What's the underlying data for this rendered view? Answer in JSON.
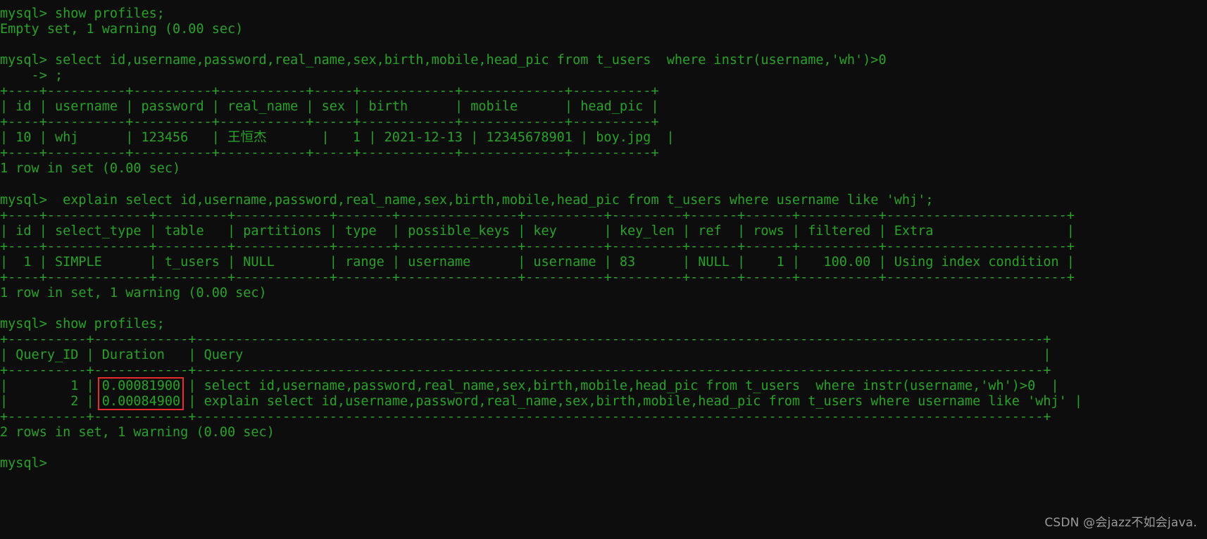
{
  "terminal": {
    "title": "mysql-client-terminal",
    "prompt": "mysql>",
    "colors": {
      "background": "#0d0d0d",
      "text": "#27a327",
      "highlight_border": "#e82c2c",
      "watermark": "#9a9a9a"
    },
    "lines": [
      "mysql> show profiles;",
      "Empty set, 1 warning (0.00 sec)",
      "",
      "mysql> select id,username,password,real_name,sex,birth,mobile,head_pic from t_users  where instr(username,'wh')>0",
      "    -> ;",
      "+----+----------+----------+-----------+-----+------------+-------------+----------+",
      "| id | username | password | real_name | sex | birth      | mobile      | head_pic |",
      "+----+----------+----------+-----------+-----+------------+-------------+----------+",
      "| 10 | whj      | 123456   | 王恒杰       |   1 | 2021-12-13 | 12345678901 | boy.jpg  |",
      "+----+----------+----------+-----------+-----+------------+-------------+----------+",
      "1 row in set (0.00 sec)",
      "",
      "mysql>  explain select id,username,password,real_name,sex,birth,mobile,head_pic from t_users where username like 'whj';",
      "+----+-------------+---------+------------+-------+---------------+----------+---------+------+------+----------+-----------------------+",
      "| id | select_type | table   | partitions | type  | possible_keys | key      | key_len | ref  | rows | filtered | Extra                 |",
      "+----+-------------+---------+------------+-------+---------------+----------+---------+------+------+----------+-----------------------+",
      "|  1 | SIMPLE      | t_users | NULL       | range | username      | username | 83      | NULL |    1 |   100.00 | Using index condition |",
      "+----+-------------+---------+------------+-------+---------------+----------+---------+------+------+----------+-----------------------+",
      "1 row in set, 1 warning (0.00 sec)",
      "",
      "mysql> show profiles;",
      "+----------+------------+------------------------------------------------------------------------------------------------------------+",
      "| Query_ID | Duration   | Query                                                                                                      |",
      "+----------+------------+------------------------------------------------------------------------------------------------------------+",
      "|        1 | 0.00081900 | select id,username,password,real_name,sex,birth,mobile,head_pic from t_users  where instr(username,'wh')>0  |",
      "|        2 | 0.00084900 | explain select id,username,password,real_name,sex,birth,mobile,head_pic from t_users where username like 'whj' |",
      "+----------+------------+------------------------------------------------------------------------------------------------------------+",
      "2 rows in set, 1 warning (0.00 sec)",
      "",
      "mysql>"
    ],
    "commands": [
      "show profiles;",
      "select id,username,password,real_name,sex,birth,mobile,head_pic from t_users  where instr(username,'wh')>0",
      "explain select id,username,password,real_name,sex,birth,mobile,head_pic from t_users where username like 'whj';",
      "show profiles;"
    ],
    "status_messages": [
      "Empty set, 1 warning (0.00 sec)",
      "1 row in set (0.00 sec)",
      "1 row in set, 1 warning (0.00 sec)",
      "2 rows in set, 1 warning (0.00 sec)"
    ],
    "tables": {
      "users_result": {
        "columns": [
          "id",
          "username",
          "password",
          "real_name",
          "sex",
          "birth",
          "mobile",
          "head_pic"
        ],
        "rows": [
          [
            "10",
            "whj",
            "123456",
            "王恒杰",
            "1",
            "2021-12-13",
            "12345678901",
            "boy.jpg"
          ]
        ]
      },
      "explain_result": {
        "columns": [
          "id",
          "select_type",
          "table",
          "partitions",
          "type",
          "possible_keys",
          "key",
          "key_len",
          "ref",
          "rows",
          "filtered",
          "Extra"
        ],
        "rows": [
          [
            "1",
            "SIMPLE",
            "t_users",
            "NULL",
            "range",
            "username",
            "username",
            "83",
            "NULL",
            "1",
            "100.00",
            "Using index condition"
          ]
        ]
      },
      "profiles_result": {
        "columns": [
          "Query_ID",
          "Duration",
          "Query"
        ],
        "rows": [
          [
            "1",
            "0.00081900",
            "select id,username,password,real_name,sex,birth,mobile,head_pic from t_users  where instr(username,'wh')>0"
          ],
          [
            "2",
            "0.00084900",
            "explain select id,username,password,real_name,sex,birth,mobile,head_pic from t_users where username like 'whj'"
          ]
        ]
      }
    }
  },
  "watermark": {
    "text": "CSDN @会jazz不如会java."
  }
}
